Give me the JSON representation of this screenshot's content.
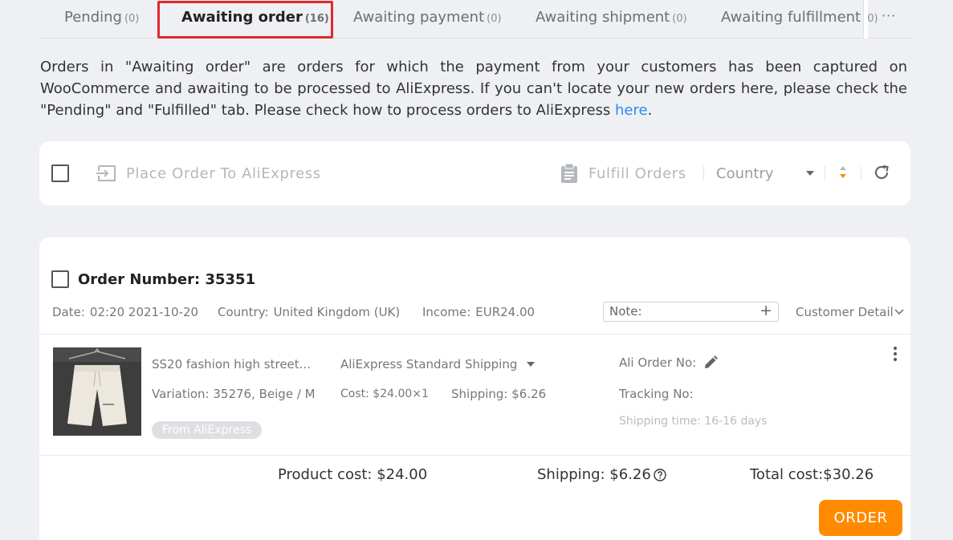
{
  "tabs": [
    {
      "label": "Pending",
      "count": "(0)"
    },
    {
      "label": "Awaiting order",
      "count": "(16)"
    },
    {
      "label": "Awaiting payment",
      "count": "(0)"
    },
    {
      "label": "Awaiting shipment",
      "count": "(0)"
    },
    {
      "label": "Awaiting fulfillment",
      "count": "(0)"
    }
  ],
  "more": "···",
  "description": {
    "text": "Orders in \"Awaiting order\" are orders for which the payment from your customers has been captured on WooCommerce and awaiting to be processed to AliExpress. If you can't locate your new orders here, please check the \"Pending\" and \"Fulfilled\" tab. Please check how to process orders to AliExpress ",
    "link": "here",
    "end": "."
  },
  "toolbar": {
    "place_order": "Place Order To AliExpress",
    "fulfill": "Fulfill Orders",
    "country": "Country"
  },
  "order": {
    "number_label": "Order Number: 35351",
    "date_label": "Date:",
    "date": "02:20 2021-10-20",
    "country_label": "Country:",
    "country": "United Kingdom (UK)",
    "income_label": "Income:",
    "income": "EUR24.00",
    "note_placeholder": "Note:",
    "customer_detail": "Customer Detail",
    "product_name": "SS20 fashion high street...",
    "variation": "Variation: 35276, Beige / M",
    "badge": "From AliExpress",
    "shipping_method": "AliExpress Standard Shipping",
    "cost": "Cost: $24.00×1",
    "shipping": "Shipping: $6.26",
    "ali_order_no": "Ali Order No:",
    "tracking_no": "Tracking No:",
    "shipping_time": "Shipping time: 16-16 days",
    "product_cost": "Product cost: $24.00",
    "shipping_total": "Shipping: $6.26",
    "total_cost": "Total cost:$30.26",
    "order_button": "ORDER"
  },
  "colors": {
    "accent": "#ff8a00",
    "link": "#2d8cf0",
    "highlight": "#e0282c",
    "background": "#eef0f3"
  }
}
